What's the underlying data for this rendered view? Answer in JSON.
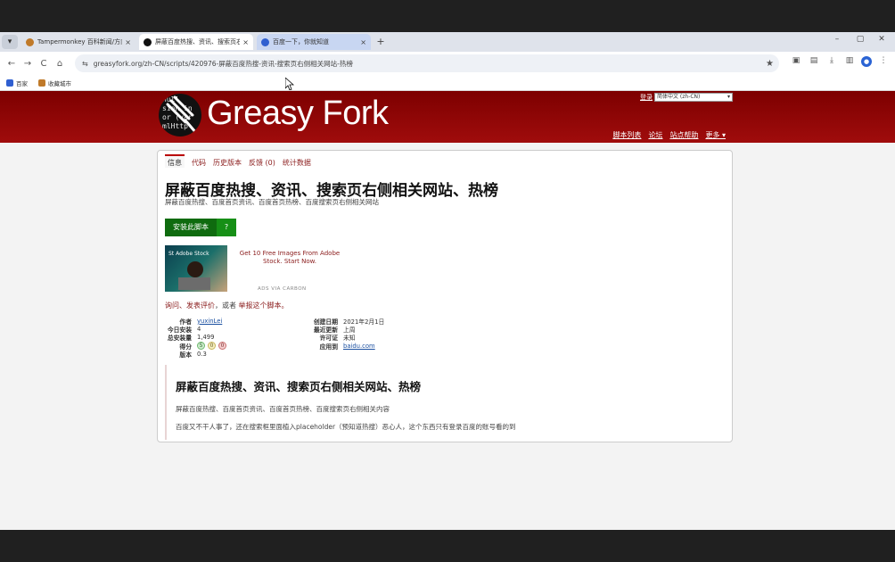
{
  "browser": {
    "tabs": [
      {
        "label": "Tampermonkey 百科新闻/方向",
        "state": "inactive",
        "favicon_color": "#c07a2a"
      },
      {
        "label": "屏蔽百度热搜、资讯、搜索页右",
        "state": "active",
        "favicon_color": "#111111"
      },
      {
        "label": "百度一下，你就知道",
        "state": "hover",
        "favicon_color": "#2f5fd0"
      }
    ],
    "tab_menu_icon": "chevron-down-icon",
    "tab_close_symbol": "×",
    "new_tab_symbol": "+",
    "window_controls": [
      "–",
      "▢",
      "✕"
    ],
    "nav": {
      "back": "←",
      "forward": "→",
      "reload": "C",
      "home": "⌂"
    },
    "url": "greasyfork.org/zh-CN/scripts/420976-屏蔽百度热搜-资讯-搜索页右侧相关网站-热榜",
    "toolbar_icons": [
      "★",
      "▣",
      "▤",
      "⤓",
      "▥",
      "●",
      "⋮"
    ],
    "bookmarks": [
      {
        "label": "百家",
        "icon_color": "#2f5fd0"
      },
      {
        "label": "收藏城市",
        "icon_color": "#c07a2a"
      }
    ]
  },
  "site": {
    "logo_code": "null\nsion in\nor (var\nmlHttp",
    "title": "Greasy Fork",
    "login": "登录",
    "language": "简体中文 (zh-CN)",
    "nav": [
      "脚本列表",
      "论坛",
      "站点帮助",
      "更多 ▾"
    ]
  },
  "script": {
    "tabs": [
      "信息",
      "代码",
      "历史版本",
      "反馈 (0)",
      "统计数据"
    ],
    "title": "屏蔽百度热搜、资讯、搜索页右侧相关网站、热榜",
    "description": "屏蔽百度热搜、百度首页资讯、百度首页热榜、百度搜索页右侧相关网站",
    "install_label": "安装此脚本",
    "install_help": "?",
    "ad": {
      "badge": "St  Adobe Stock",
      "text": "Get 10 Free Images From Adobe Stock. Start Now.",
      "via": "ADS VIA CARBON"
    },
    "feedback_link": "询问、发表评价",
    "feedback_or": "，或者",
    "report_link": "举报这个脚本。",
    "meta_left": [
      {
        "k": "作者",
        "v": "yuxinLei",
        "link": true
      },
      {
        "k": "今日安装",
        "v": "4",
        "link": false
      },
      {
        "k": "总安装量",
        "v": "1,499",
        "link": false
      },
      {
        "k": "得分",
        "v": "",
        "link": false,
        "ratings": [
          "5",
          "0",
          "0"
        ]
      },
      {
        "k": "版本",
        "v": "0.3",
        "link": false
      }
    ],
    "meta_right": [
      {
        "k": "创建日期",
        "v": "2021年2月1日",
        "link": false
      },
      {
        "k": "最近更新",
        "v": "上周",
        "link": false
      },
      {
        "k": "许可证",
        "v": "未知",
        "link": false
      },
      {
        "k": "应用到",
        "v": "baidu.com",
        "link": true
      }
    ],
    "additional": {
      "title": "屏蔽百度热搜、资讯、搜索页右侧相关网站、热榜",
      "line1": "屏蔽百度热搜、百度首页资讯、百度首页热榜、百度搜索页右侧相关内容",
      "line2": "百度又不干人事了，还在搜索框里面植入placeholder（预知道热搜）恶心人，这个东西只有登录百度的账号看的到"
    }
  }
}
